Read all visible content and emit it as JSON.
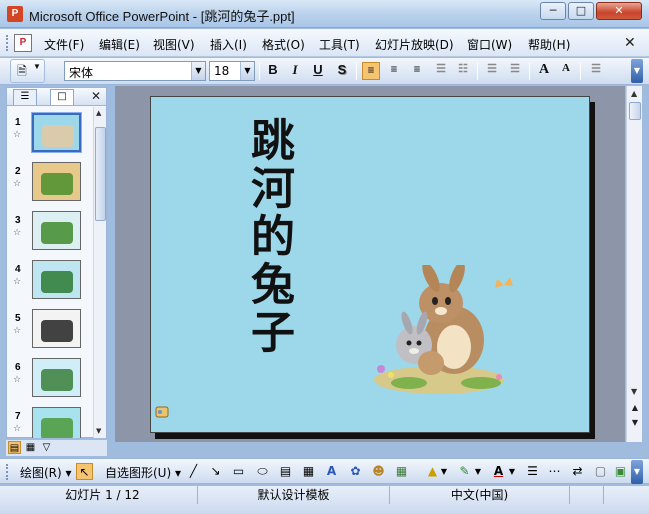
{
  "window": {
    "title": "Microsoft Office PowerPoint - [跳河的兔子.ppt]",
    "app_icon": "P"
  },
  "menu": {
    "items": [
      "文件(F)",
      "编辑(E)",
      "视图(V)",
      "插入(I)",
      "格式(O)",
      "工具(T)",
      "幻灯片放映(D)",
      "窗口(W)",
      "帮助(H)"
    ]
  },
  "toolbar": {
    "font_name": "宋体",
    "font_size": "18",
    "bold": "B",
    "italic": "I",
    "underline": "U",
    "shadow": "S",
    "grow_font": "A",
    "shrink_font": "A"
  },
  "outline_pane": {
    "tabs": [
      "outline-tab",
      "slides-tab"
    ],
    "selected_slide": 1,
    "slides": [
      {
        "number": "1",
        "bg": "#9cd8ea",
        "accent": "#e5c9a2"
      },
      {
        "number": "2",
        "bg": "#e7c98c",
        "accent": "#4a8f2b"
      },
      {
        "number": "3",
        "bg": "#dceff2",
        "accent": "#3f8b2c"
      },
      {
        "number": "4",
        "bg": "#bde6f0",
        "accent": "#2c7a34"
      },
      {
        "number": "5",
        "bg": "#f3f3f3",
        "accent": "#222222"
      },
      {
        "number": "6",
        "bg": "#cfeef8",
        "accent": "#3a7e3a"
      },
      {
        "number": "7",
        "bg": "#a9e2ef",
        "accent": "#4c9a3a"
      }
    ]
  },
  "slide": {
    "title": "跳河的兔子",
    "background": "#9cd8ea"
  },
  "drawing_toolbar": {
    "draw_label": "绘图(R)",
    "autoshapes_label": "自选图形(U)"
  },
  "status": {
    "slide_counter": "幻灯片 1 / 12",
    "design": "默认设计模板",
    "language": "中文(中国)"
  },
  "colors": {
    "accent": "#f6c36e",
    "titlebar": "#b9d1ec",
    "workspace": "#8d96a8"
  }
}
